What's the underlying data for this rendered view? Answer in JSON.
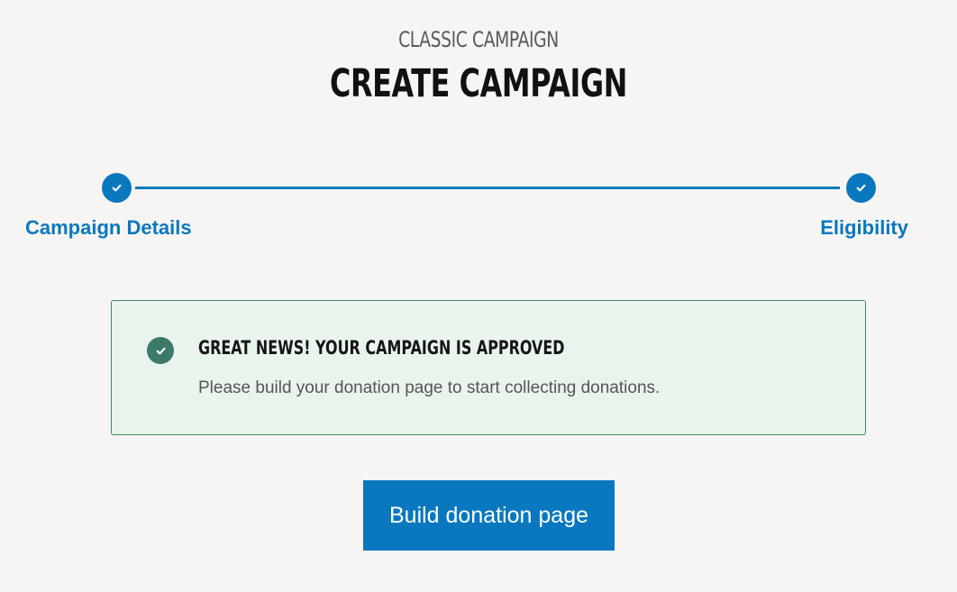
{
  "header": {
    "eyebrow": "CLASSIC CAMPAIGN",
    "title": "CREATE CAMPAIGN"
  },
  "stepper": {
    "steps": [
      {
        "label": "Campaign Details",
        "status": "complete",
        "icon": "check-icon"
      },
      {
        "label": "Eligibility",
        "status": "complete",
        "icon": "check-icon"
      }
    ],
    "accent_color": "#0a78be"
  },
  "alert": {
    "icon": "check-circle-icon",
    "title": "GREAT NEWS! YOUR CAMPAIGN IS APPROVED",
    "message": "Please build your donation page to start collecting donations.",
    "background_color": "#e9f5ec",
    "border_color": "#3a8a6a",
    "icon_color": "#3b7a68"
  },
  "actions": {
    "build_label": "Build donation page",
    "button_color": "#0a78be"
  }
}
